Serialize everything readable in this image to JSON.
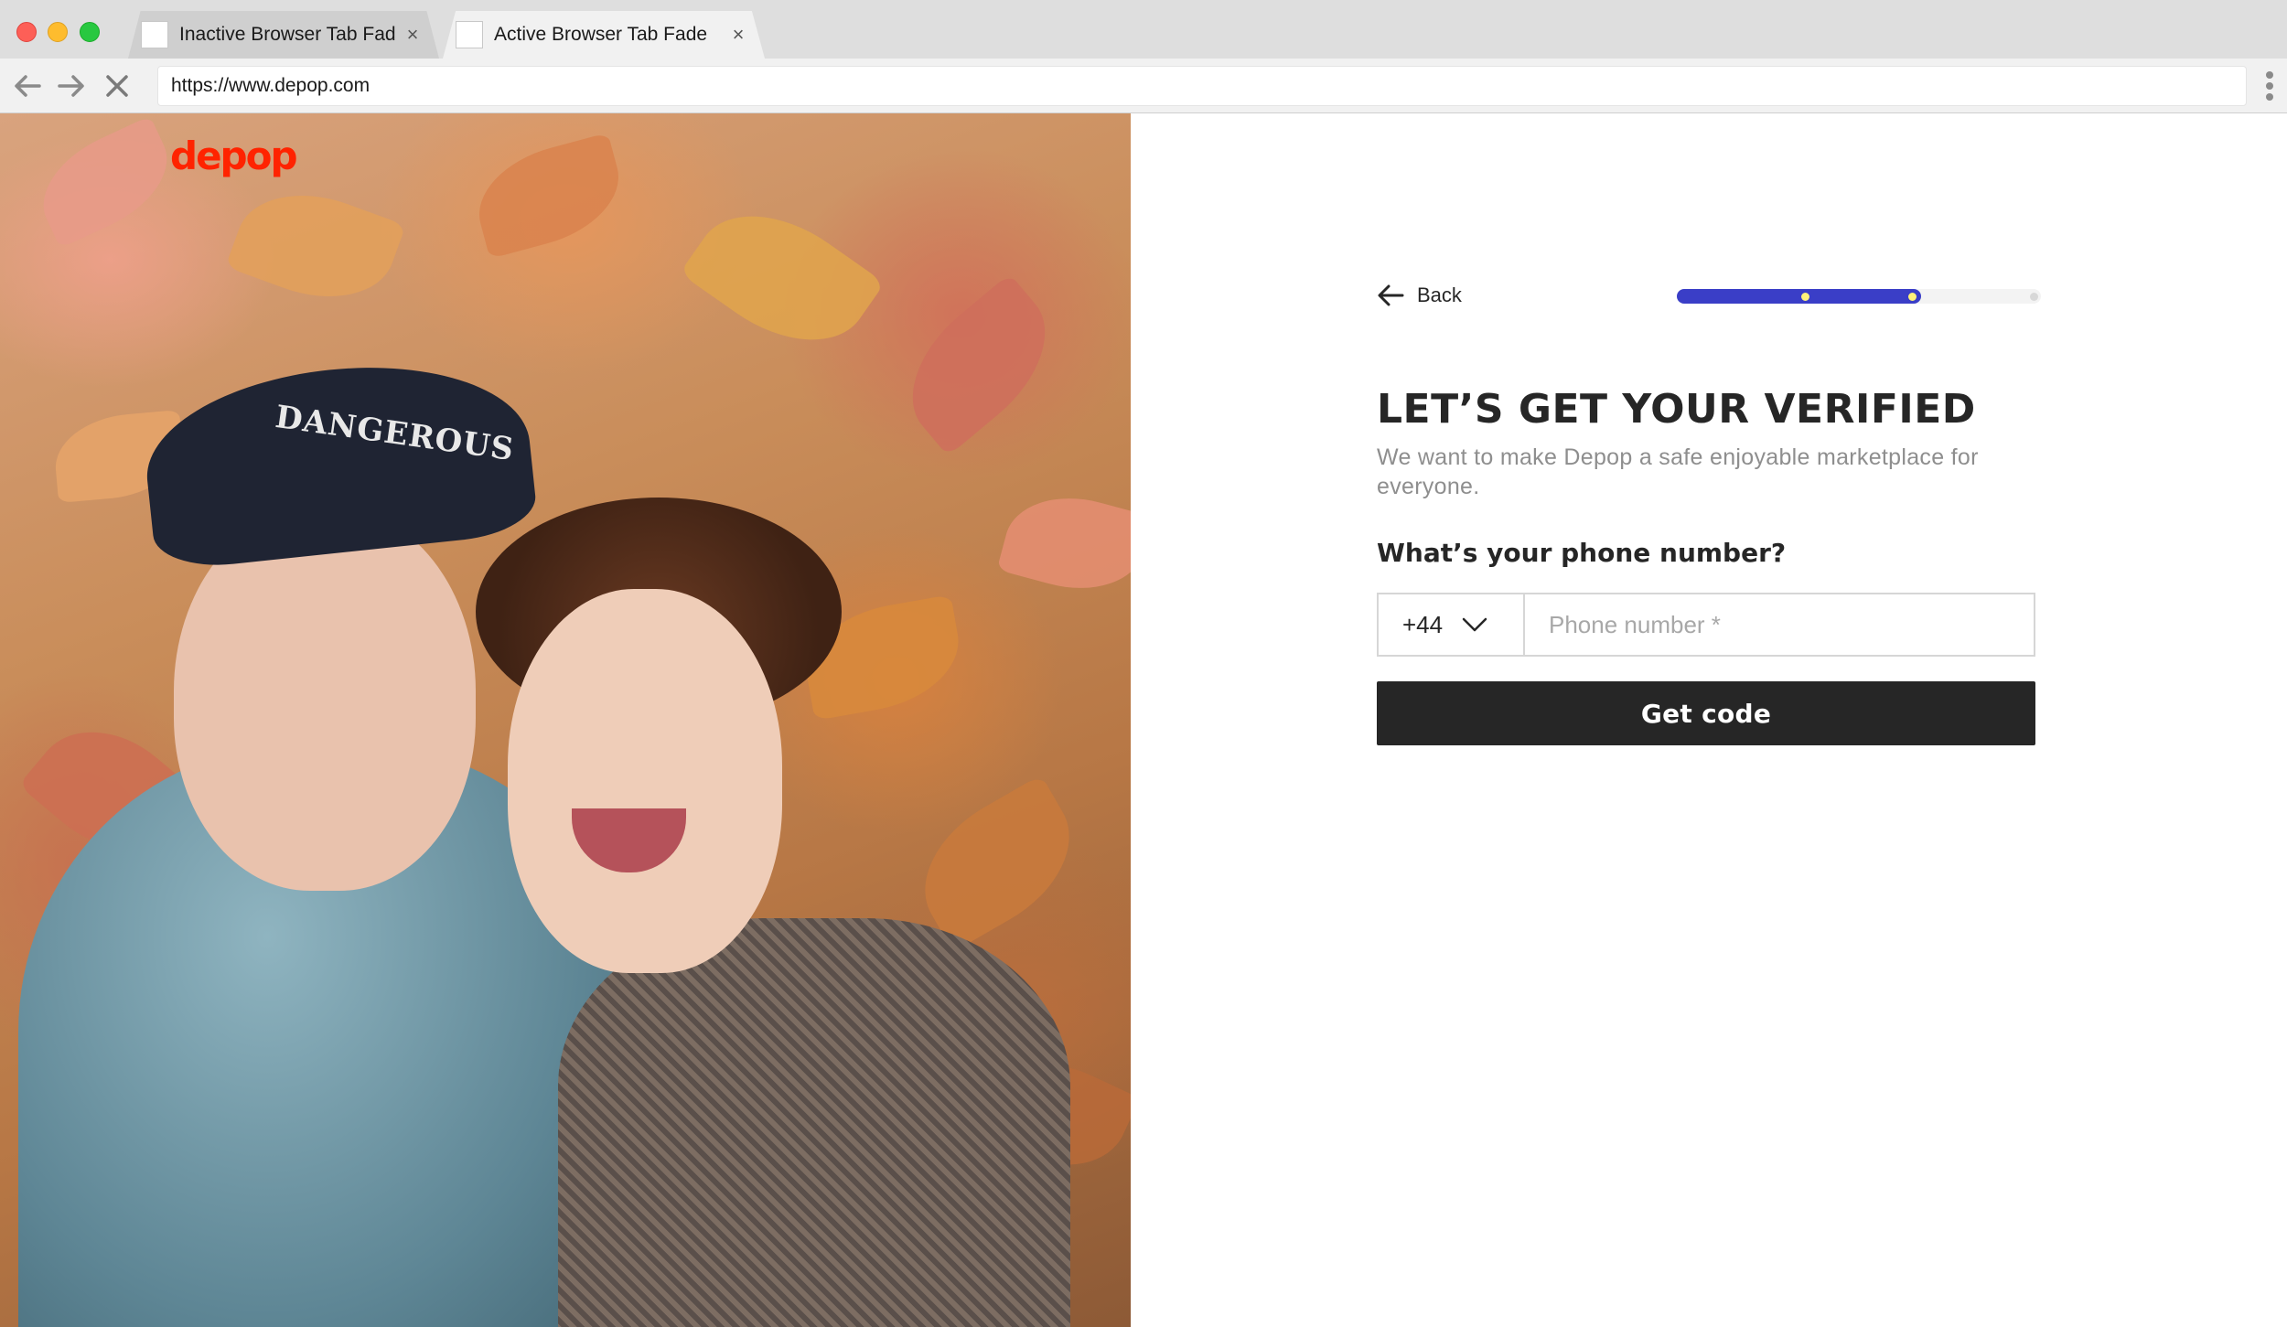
{
  "browser": {
    "tabs": [
      {
        "label": "Inactive Browser Tab Fad",
        "active": false
      },
      {
        "label": "Active Browser Tab Fade",
        "active": true
      }
    ],
    "url": "https://www.depop.com"
  },
  "brand": {
    "logo_text": "depop",
    "accent_color": "#ff2300",
    "primary_color": "#3a3ec7"
  },
  "form": {
    "back_label": "Back",
    "progress": {
      "steps": 4,
      "completed": 2,
      "fill_fraction": 0.67
    },
    "heading": "LET’S GET YOUR VERIFIED",
    "subtitle": "We want to make Depop a safe enjoyable marketplace for everyone.",
    "question": "What’s your phone number?",
    "country_code": "+44",
    "phone_placeholder": "Phone number *",
    "submit_label": "Get code"
  }
}
